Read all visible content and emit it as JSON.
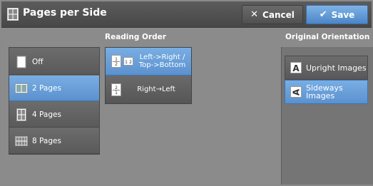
{
  "header": {
    "title": "Pages per Side",
    "cancel_label": "Cancel",
    "save_label": "Save"
  },
  "pages_per_side": {
    "options": [
      {
        "label": "Off",
        "selected": false,
        "icon": "single-page-icon"
      },
      {
        "label": "2 Pages",
        "selected": true,
        "icon": "two-pages-icon"
      },
      {
        "label": "4 Pages",
        "selected": false,
        "icon": "four-pages-icon"
      },
      {
        "label": "8 Pages",
        "selected": false,
        "icon": "eight-pages-icon"
      }
    ]
  },
  "reading_order": {
    "label": "Reading Order",
    "options": [
      {
        "label": "Left->Right / Top->Bottom",
        "selected": true
      },
      {
        "label": "Right→Left",
        "selected": false
      }
    ]
  },
  "original_orientation": {
    "label": "Original Orientation",
    "options": [
      {
        "label": "Upright Images",
        "selected": false,
        "icon": "upright-A-icon"
      },
      {
        "label": "Sideways Images",
        "selected": true,
        "icon": "sideways-A-icon"
      }
    ]
  },
  "colors": {
    "selected": "#5b91cf",
    "background": "#8b8b8b",
    "header": "#4e4e4e"
  }
}
